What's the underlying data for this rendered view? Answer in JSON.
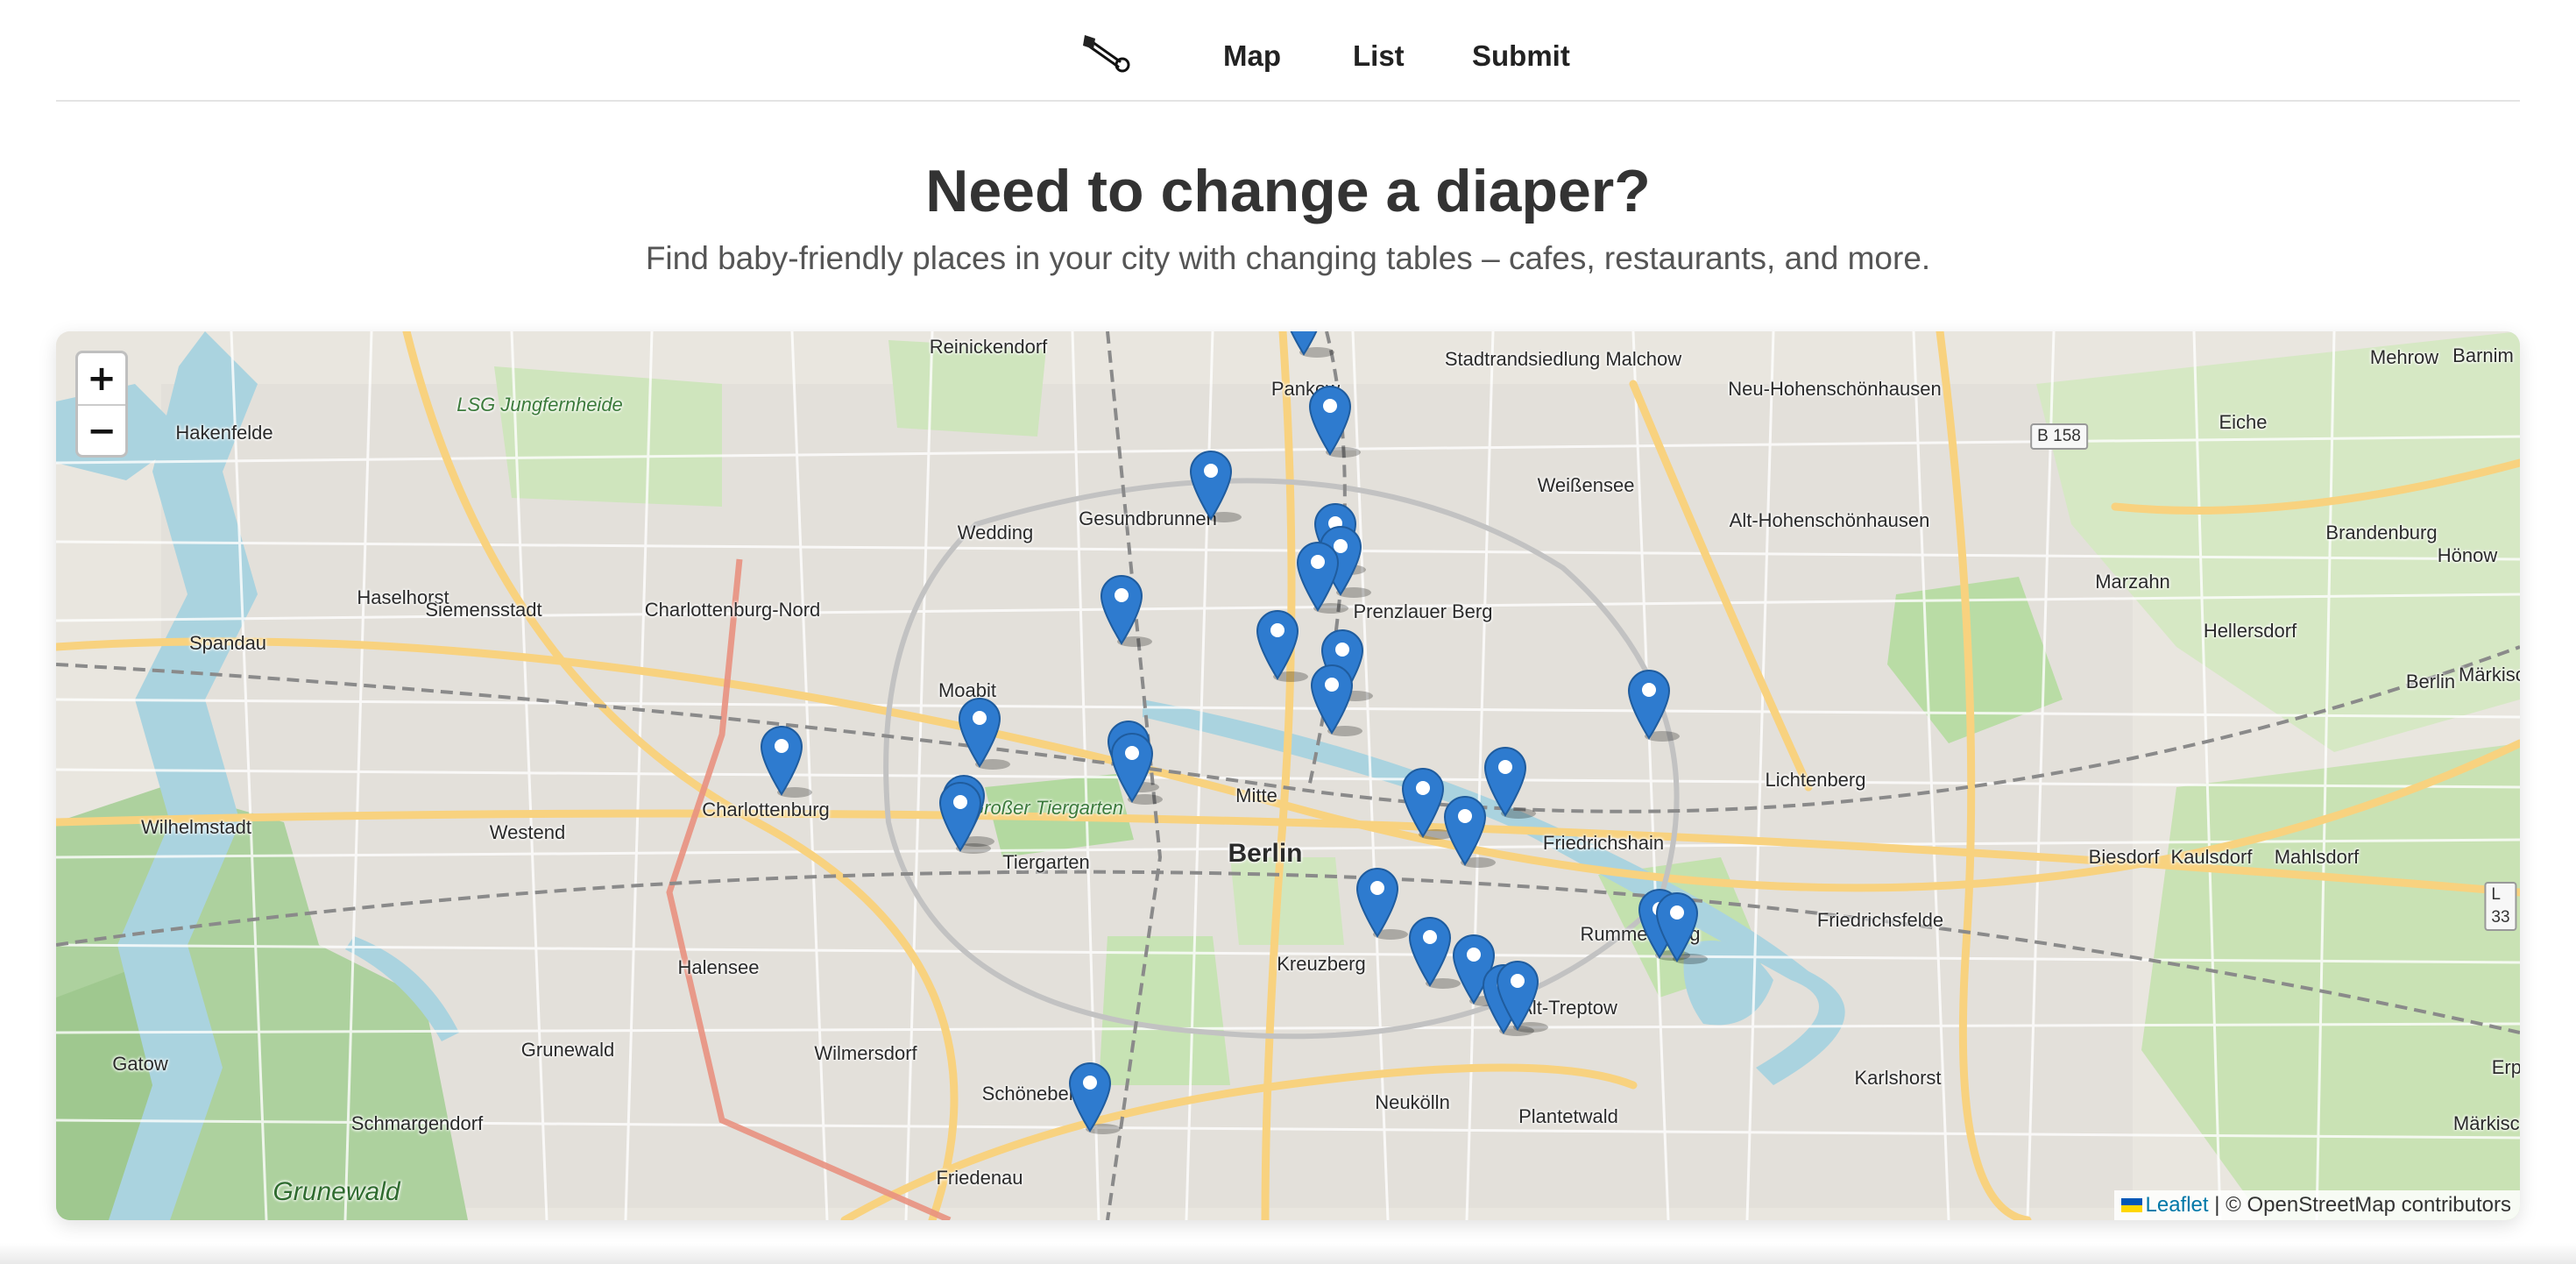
{
  "nav": {
    "logo_icon": "safety-pin-icon",
    "map_label": "Map",
    "list_label": "List",
    "submit_label": "Submit"
  },
  "hero": {
    "title": "Need to change a diaper?",
    "subtitle": "Find baby-friendly places in your city with changing tables – cafes, restaurants, and more."
  },
  "map": {
    "zoom_in_label": "+",
    "zoom_out_label": "−",
    "attribution_link": "Leaflet",
    "attribution_rest": " | © OpenStreetMap contributors",
    "colors": {
      "marker": "#2e7bcf",
      "water": "#aad3df",
      "park": "#c8e6b4",
      "forest": "#add19e",
      "major_road": "#f8d27f",
      "rail": "#888888"
    },
    "place_labels": [
      "Reinickendorf",
      "Pankow",
      "Stadtrandsiedlung Malchow",
      "Mehrow",
      "Neu-Hohenschönhausen",
      "Hakenfelde",
      "LSG Jungfernheide",
      "Eiche",
      "Weißensee",
      "Alt-Hohenschönhausen",
      "Gesundbrunnen",
      "Wedding",
      "Hönow",
      "Marzahn",
      "Haselhorst",
      "Siemensstadt",
      "Charlottenburg-Nord",
      "Prenzlauer Berg",
      "Hellersdorf",
      "Spandau",
      "Moabit",
      "Lichtenberg",
      "Charlottenburg",
      "Großer Tiergarten",
      "Mitte",
      "Berlin",
      "Wilhelmstadt",
      "Westend",
      "Tiergarten",
      "Friedrichshain",
      "Biesdorf",
      "Kaulsdorf",
      "Mahlsdorf",
      "Halensee",
      "Kreuzberg",
      "Rummelsburg",
      "Friedrichsfelde",
      "Grunewald",
      "Alt-Treptow",
      "Gatow",
      "Wilmersdorf",
      "Karlshorst",
      "Schöneberg",
      "Neukölln",
      "Schmargendorf",
      "Plantetwald",
      "Friedenau",
      "Märkisch",
      "Brandenburg",
      "Berlin",
      "Barnim",
      "Erpet",
      "Märkische"
    ],
    "road_shields": [
      "B 158",
      "L 33"
    ],
    "markers": [
      "marker",
      "marker",
      "marker",
      "marker",
      "marker",
      "marker",
      "marker",
      "marker",
      "marker",
      "marker",
      "marker",
      "marker",
      "marker",
      "marker",
      "marker",
      "marker",
      "marker",
      "marker",
      "marker",
      "marker",
      "marker",
      "marker",
      "marker",
      "marker",
      "marker",
      "marker",
      "marker",
      "marker"
    ]
  }
}
